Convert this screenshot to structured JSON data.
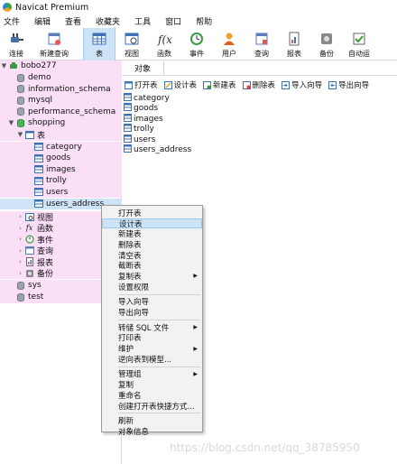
{
  "window": {
    "title": "Navicat Premium"
  },
  "menu": [
    "文件",
    "编辑",
    "查看",
    "收藏夹",
    "工具",
    "窗口",
    "帮助"
  ],
  "toolbar": [
    {
      "label": "连接",
      "icon": "plug-icon"
    },
    {
      "label": "新建查询",
      "icon": "new-query-icon"
    },
    {
      "label": "表",
      "icon": "table-icon"
    },
    {
      "label": "视图",
      "icon": "view-icon"
    },
    {
      "label": "函数",
      "icon": "function-icon"
    },
    {
      "label": "事件",
      "icon": "clock-icon"
    },
    {
      "label": "用户",
      "icon": "user-icon"
    },
    {
      "label": "查询",
      "icon": "query-icon"
    },
    {
      "label": "报表",
      "icon": "report-icon"
    },
    {
      "label": "备份",
      "icon": "backup-icon"
    },
    {
      "label": "自动运",
      "icon": "automation-icon"
    }
  ],
  "tree": {
    "connection": "bobo277",
    "databases": [
      "demo",
      "information_schema",
      "mysql",
      "performance_schema",
      "shopping",
      "sys",
      "test"
    ],
    "tables_folder": "表",
    "tables": [
      "category",
      "goods",
      "images",
      "trolly",
      "users",
      "users_address"
    ],
    "shopping_folders": [
      "视图",
      "函数",
      "事件",
      "查询",
      "报表",
      "备份"
    ]
  },
  "objects": {
    "tab_label": "对象",
    "actions": [
      "打开表",
      "设计表",
      "新建表",
      "删除表",
      "导入向导",
      "导出向导"
    ],
    "items": [
      "category",
      "goods",
      "images",
      "trolly",
      "users",
      "users_address"
    ]
  },
  "context_menu": {
    "groups": [
      [
        "打开表",
        "设计表",
        "新建表",
        "删除表",
        "清空表",
        "截断表",
        "复制表",
        "设置权限"
      ],
      [
        "导入向导",
        "导出向导"
      ],
      [
        "转储 SQL 文件",
        "打印表",
        "维护",
        "逆向表到模型..."
      ],
      [
        "管理组",
        "复制",
        "重命名",
        "创建打开表快捷方式..."
      ],
      [
        "刷新",
        "对象信息"
      ]
    ],
    "highlighted": "设计表",
    "submenu_items": [
      "复制表",
      "转储 SQL 文件",
      "维护",
      "管理组"
    ]
  },
  "watermark": "https://blog.csdn.net/qq_38785950",
  "colors": {
    "selected_bg": "#cfe3f6",
    "pink_bg": "#fbdff7",
    "active_tool": "#cde3f7"
  }
}
